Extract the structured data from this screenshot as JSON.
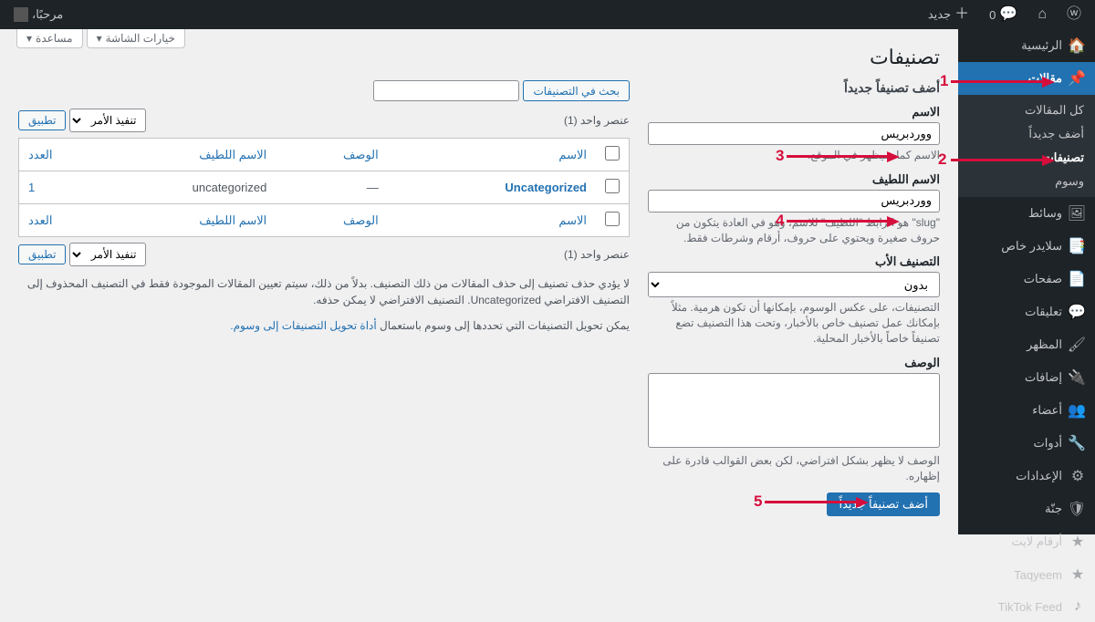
{
  "adminbar": {
    "greeting": "مرحبًا،",
    "comments_count": "0",
    "new_label": "جديد"
  },
  "sidebar": {
    "items": [
      {
        "icon": "🏠",
        "label": "الرئيسية"
      },
      {
        "icon": "📌",
        "label": "مقالات",
        "current": true
      },
      {
        "icon": "🖼",
        "label": "وسائط"
      },
      {
        "icon": "📑",
        "label": "سلايدر خاص"
      },
      {
        "icon": "📄",
        "label": "صفحات"
      },
      {
        "icon": "💬",
        "label": "تعليقات"
      },
      {
        "icon": "🖌",
        "label": "المظهر"
      },
      {
        "icon": "🔌",
        "label": "إضافات"
      },
      {
        "icon": "👥",
        "label": "أعضاء"
      },
      {
        "icon": "🔧",
        "label": "أدوات"
      },
      {
        "icon": "⚙",
        "label": "الإعدادات"
      },
      {
        "icon": "🛡",
        "label": "جنّة"
      },
      {
        "icon": "★",
        "label": "أرقام لايت"
      },
      {
        "icon": "★",
        "label": "Taqyeem"
      },
      {
        "icon": "♪",
        "label": "TikTok Feed"
      }
    ],
    "submenu": [
      {
        "label": "كل المقالات"
      },
      {
        "label": "أضف جديداً"
      },
      {
        "label": "تصنيفات",
        "current": true
      },
      {
        "label": "وسوم"
      }
    ]
  },
  "page": {
    "title": "تصنيفات",
    "screen_options": "خيارات الشاشة",
    "help": "مساعدة"
  },
  "form": {
    "heading": "أضف تصنيفاً جديداً",
    "name_label": "الاسم",
    "name_value": "ووردبريس",
    "name_desc": "الاسم كما سيظهر في الموقع.",
    "slug_label": "الاسم اللطيف",
    "slug_value": "ووردبريس",
    "slug_desc": "\"slug\" هو الرابط \"اللطيف\" للاسم، وهو في العادة يتكون من حروف صغيرة ويحتوي على حروف، أرقام وشرطات فقط.",
    "parent_label": "التصنيف الأب",
    "parent_value": "بدون",
    "parent_desc": "التصنيفات، على عكس الوسوم، بإمكانها أن تكون هرمية. مثلاً بإمكانك عمل تصنيف خاص بالأخبار، وتحت هذا التصنيف تضع تصنيفاً خاصاً بالأخبار المحلية.",
    "desc_label": "الوصف",
    "desc_value": "",
    "desc_desc": "الوصف لا يظهر بشكل افتراضي، لكن بعض القوالب قادرة على إظهاره.",
    "submit": "أضف تصنيفاً جديداً"
  },
  "list": {
    "search_button": "بحث في التصنيفات",
    "bulk_action": "تنفيذ الأمر",
    "apply": "تطبيق",
    "count_text": "عنصر واحد (1)",
    "cols": {
      "name": "الاسم",
      "desc": "الوصف",
      "slug": "الاسم اللطيف",
      "count": "العدد"
    },
    "rows": [
      {
        "name": "Uncategorized",
        "desc": "—",
        "slug": "uncategorized",
        "count": "1"
      }
    ],
    "note1": "لا يؤدي حذف تصنيف إلى حذف المقالات من ذلك التصنيف. بدلاً من ذلك، سيتم تعيين المقالات الموجودة فقط في التصنيف المحذوف إلى التصنيف الافتراضي Uncategorized. التصنيف الافتراضي لا يمكن حذفه.",
    "note2_a": "يمكن تحويل التصنيفات التي تحددها إلى وسوم باستعمال ",
    "note2_link": "أداة تحويل التصنيفات إلى وسوم."
  },
  "annotations": {
    "n1": "1",
    "n2": "2",
    "n3": "3",
    "n4": "4",
    "n5": "5"
  }
}
